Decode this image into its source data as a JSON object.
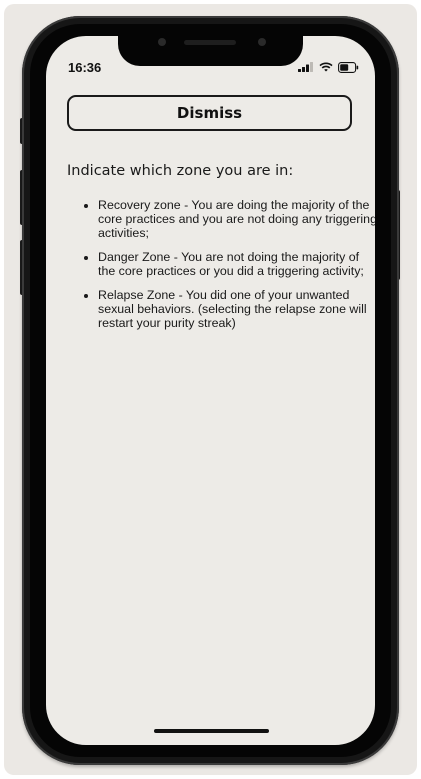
{
  "status_bar": {
    "time": "16:36",
    "icons": [
      "signal-icon",
      "wifi-icon",
      "battery-icon"
    ]
  },
  "dismiss_button": {
    "label": "Dismiss"
  },
  "content": {
    "heading": "Indicate which zone you are in:",
    "zones": [
      "Recovery zone - You are doing the majority of the core practices and you are not doing any triggering activities;",
      "Danger Zone - You are not doing the majority of the core practices or you did a triggering activity;",
      "Relapse Zone - You did one of your unwanted sexual behaviors. (selecting the relapse zone will restart your purity streak)"
    ]
  },
  "colors": {
    "screen_background": "#edebe7",
    "text": "#1a1a1a",
    "frame": "#161616"
  }
}
